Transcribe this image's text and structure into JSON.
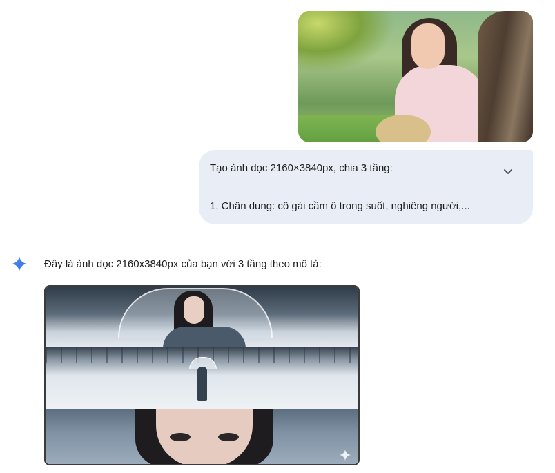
{
  "conversation": {
    "user": {
      "prompt_lines": [
        "Tạo ảnh dọc 2160×3840px, chia 3 tầng:",
        "1. Chân dung: cô gái cầm ô trong suốt, nghiêng người,..."
      ]
    },
    "model": {
      "response_text": "Đây là ảnh dọc 2160x3840px của bạn với 3 tầng theo mô tả:"
    }
  },
  "icons": {
    "expand": "chevron-down-icon",
    "assistant": "gemini-sparkle-icon",
    "watermark": "sparkle-watermark-icon"
  },
  "colors": {
    "bubble_bg": "#e9eef6",
    "gemini_blue": "#4285f4",
    "text": "#1f1f1f"
  }
}
